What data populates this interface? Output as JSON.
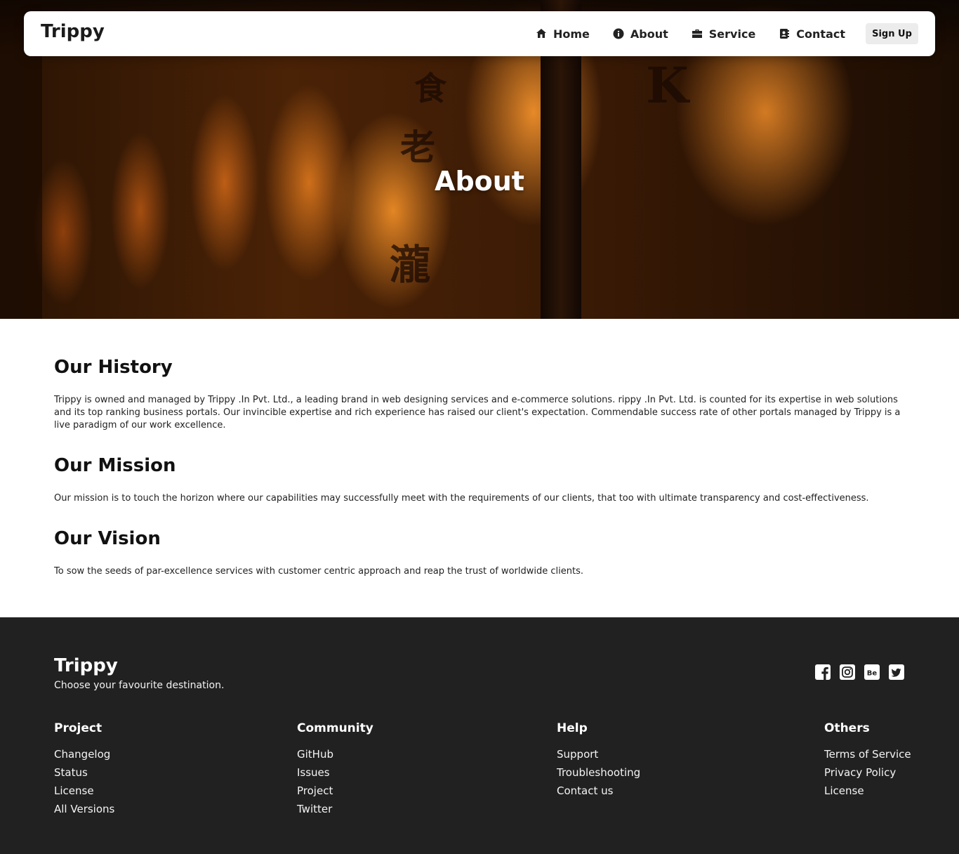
{
  "nav": {
    "brand": "Trippy",
    "links": [
      {
        "label": "Home",
        "icon": "home-icon"
      },
      {
        "label": "About",
        "icon": "info-icon"
      },
      {
        "label": "Service",
        "icon": "briefcase-icon"
      },
      {
        "label": "Contact",
        "icon": "contact-book-icon"
      }
    ],
    "signup_label": "Sign Up"
  },
  "hero": {
    "title": "About"
  },
  "sections": [
    {
      "heading": "Our History",
      "text": "Trippy is owned and managed by Trippy .In Pvt. Ltd., a leading brand in web designing services and e-commerce solutions. rippy .In Pvt. Ltd. is counted for its expertise in web solutions and its top ranking business portals. Our invincible expertise and rich experience has raised our client's expectation. Commendable success rate of other portals managed by Trippy is a live paradigm of our work excellence."
    },
    {
      "heading": "Our Mission",
      "text": "Our mission is to touch the horizon where our capabilities may successfully meet with the requirements of our clients, that too with ultimate transparency and cost-effectiveness."
    },
    {
      "heading": "Our Vision",
      "text": "To sow the seeds of par-excellence services with customer centric approach and reap the trust of worldwide clients."
    }
  ],
  "footer": {
    "brand": "Trippy",
    "tagline": "Choose your favourite destination.",
    "socials": [
      "facebook-icon",
      "instagram-icon",
      "behance-icon",
      "twitter-icon"
    ],
    "behance_text": "Be",
    "columns": [
      {
        "title": "Project",
        "links": [
          "Changelog",
          "Status",
          "License",
          "All Versions"
        ]
      },
      {
        "title": "Community",
        "links": [
          "GitHub",
          "Issues",
          "Project",
          "Twitter"
        ]
      },
      {
        "title": "Help",
        "links": [
          "Support",
          "Troubleshooting",
          "Contact us"
        ]
      },
      {
        "title": "Others",
        "links": [
          "Terms of Service",
          "Privacy Policy",
          "License"
        ]
      }
    ]
  },
  "colors": {
    "footer_bg": "#212121",
    "nav_bg": "#ffffff",
    "accent_orange": "#e8891f"
  }
}
